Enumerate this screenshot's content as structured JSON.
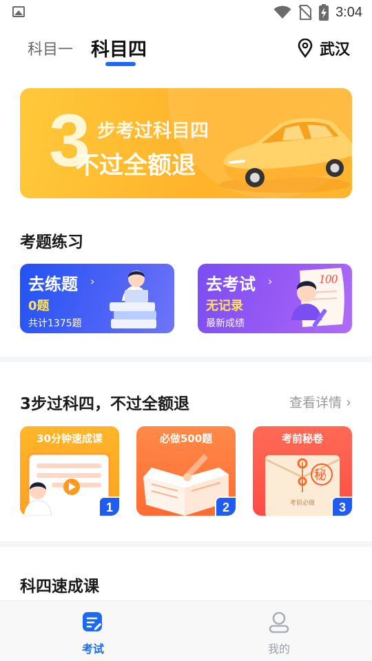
{
  "status_bar": {
    "time": "3:04"
  },
  "top_tabs": {
    "items": [
      {
        "label": "科目一",
        "active": false
      },
      {
        "label": "科目四",
        "active": true
      }
    ],
    "city": "武汉",
    "accent_color": "#1c6af4"
  },
  "banner": {
    "big_number": "3",
    "line1": "步考过科目四",
    "line2": "不过全额退"
  },
  "practice_section": {
    "title": "考题练习",
    "cards": [
      {
        "title": "去练题",
        "value": "0题",
        "sub": "共计1375题"
      },
      {
        "title": "去考试",
        "value": "无记录",
        "sub": "最新成绩"
      }
    ]
  },
  "steps_section": {
    "title": "3步过科四，不过全额退",
    "more_label": "查看详情",
    "steps": [
      {
        "title": "30分钟速成课",
        "num": "1"
      },
      {
        "title": "必做500题",
        "num": "2"
      },
      {
        "title": "考前秘卷",
        "num": "3",
        "envelope_text": "考前必做",
        "seal_text": "秘"
      }
    ]
  },
  "course_section": {
    "title": "科四速成课"
  },
  "bottom_tabs": [
    {
      "label": "考试",
      "icon": "exam-icon",
      "active": true
    },
    {
      "label": "我的",
      "icon": "profile-icon",
      "active": false
    }
  ],
  "colors": {
    "primary": "#1c6af4",
    "banner": "#ffb32b",
    "practice_card": "#2252f3",
    "exam_card": "#8a55f4",
    "highlight_text": "#ffe35a"
  }
}
